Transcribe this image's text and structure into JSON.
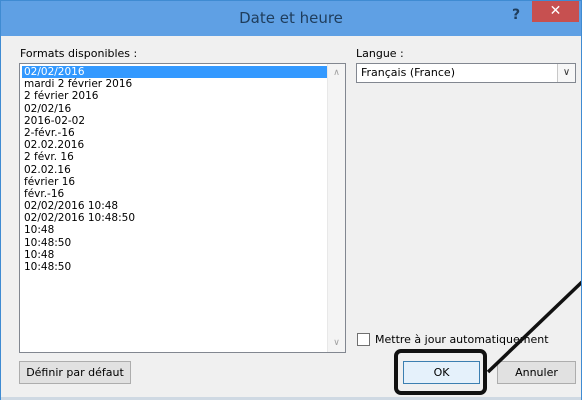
{
  "window": {
    "title": "Date et heure",
    "help_label": "?",
    "close_label": "✕"
  },
  "formats": {
    "label": "Formats disponibles :",
    "items": [
      "02/02/2016",
      "mardi 2 février 2016",
      "2 février 2016",
      "02/02/16",
      "2016-02-02",
      "2-févr.-16",
      "02.02.2016",
      "2 févr. 16",
      "02.02.16",
      "février 16",
      "févr.-16",
      "02/02/2016 10:48",
      "02/02/2016 10:48:50",
      "10:48",
      "10:48:50",
      "10:48",
      "10:48:50"
    ],
    "selected_index": 0
  },
  "langue": {
    "label": "Langue :",
    "value": "Français (France)"
  },
  "auto_update": {
    "label": "Mettre à jour automatiquement",
    "checked": false
  },
  "buttons": {
    "default": "Définir par défaut",
    "ok": "OK",
    "cancel": "Annuler"
  },
  "colors": {
    "title_bar": "#5fa0e4",
    "close": "#c75050",
    "selection": "#3399ff",
    "callout": "#111111"
  }
}
